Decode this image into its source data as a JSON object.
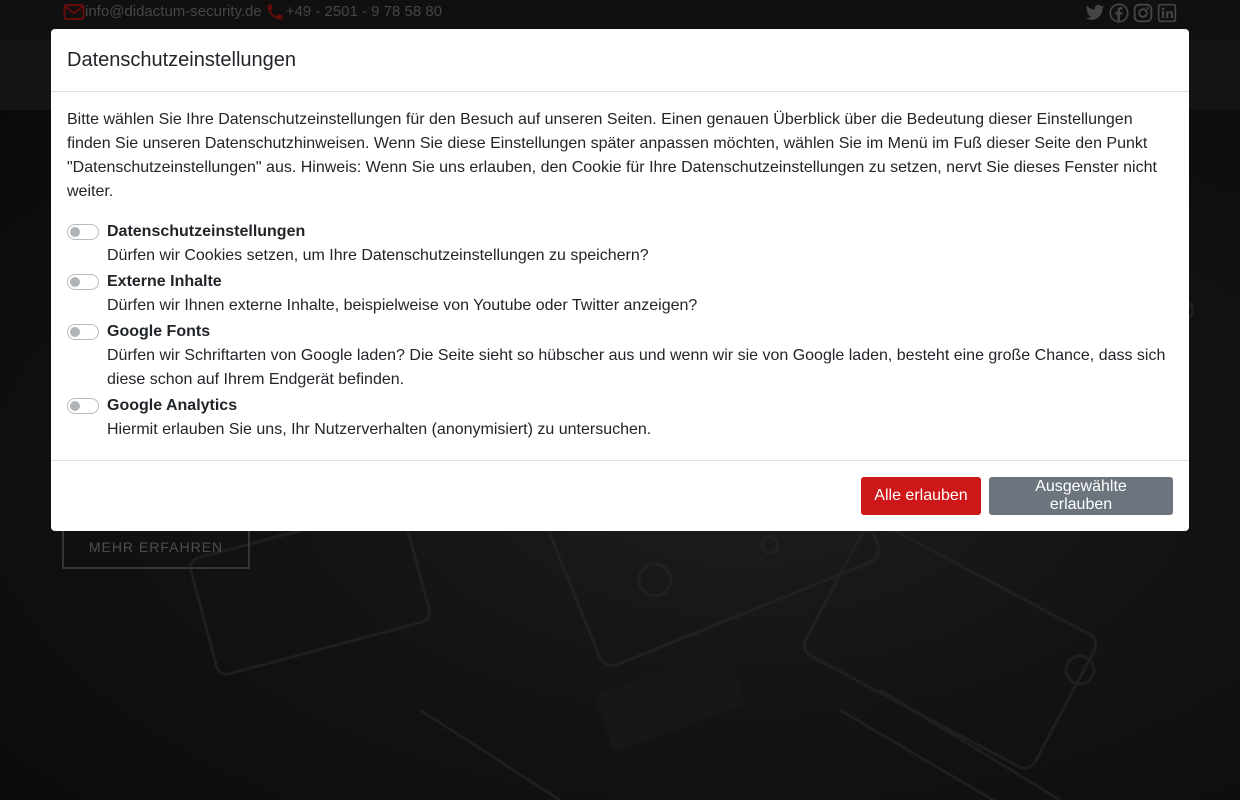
{
  "topbar": {
    "email": "info@didactum-security.de",
    "phone": "+49 - 2501 - 9 78 58 80",
    "icons": [
      "mail-icon",
      "phone-icon"
    ],
    "social": [
      "twitter-icon",
      "facebook-icon",
      "instagram-icon",
      "linkedin-icon"
    ],
    "accent_color": "#cd1719"
  },
  "hero": {
    "more_button": "MEHR ERFAHREN"
  },
  "modal": {
    "title": "Datenschutzeinstellungen",
    "intro": "Bitte wählen Sie Ihre Datenschutzeinstellungen für den Besuch auf unseren Seiten. Einen genauen Überblick über die Bedeutung dieser Einstellungen finden Sie unseren Datenschutzhinweisen. Wenn Sie diese Einstellungen später anpassen möchten, wählen Sie im Menü im Fuß dieser Seite den Punkt \"Datenschutzeinstellungen\" aus. Hinweis: Wenn Sie uns erlauben, den Cookie für Ihre Datenschutzeinstellungen zu setzen, nervt Sie dieses Fenster nicht weiter.",
    "options": [
      {
        "label": "Datenschutzeinstellungen",
        "desc": "Dürfen wir Cookies setzen, um Ihre Datenschutzeinstellungen zu speichern?",
        "enabled": false
      },
      {
        "label": "Externe Inhalte",
        "desc": "Dürfen wir Ihnen externe Inhalte, beispielweise von Youtube oder Twitter anzeigen?",
        "enabled": false
      },
      {
        "label": "Google Fonts",
        "desc": "Dürfen wir Schriftarten von Google laden? Die Seite sieht so hübscher aus und wenn wir sie von Google laden, besteht eine große Chance, dass sich diese schon auf Ihrem Endgerät befinden.",
        "enabled": false
      },
      {
        "label": "Google Analytics",
        "desc": "Hiermit erlauben Sie uns, Ihr Nutzerverhalten (anonymisiert) zu untersuchen.",
        "enabled": false
      }
    ],
    "buttons": {
      "allow_all": "Alle erlauben",
      "allow_selected": "Ausgewählte erlauben"
    },
    "colors": {
      "primary": "#cd1719",
      "secondary": "#6c757d"
    }
  }
}
